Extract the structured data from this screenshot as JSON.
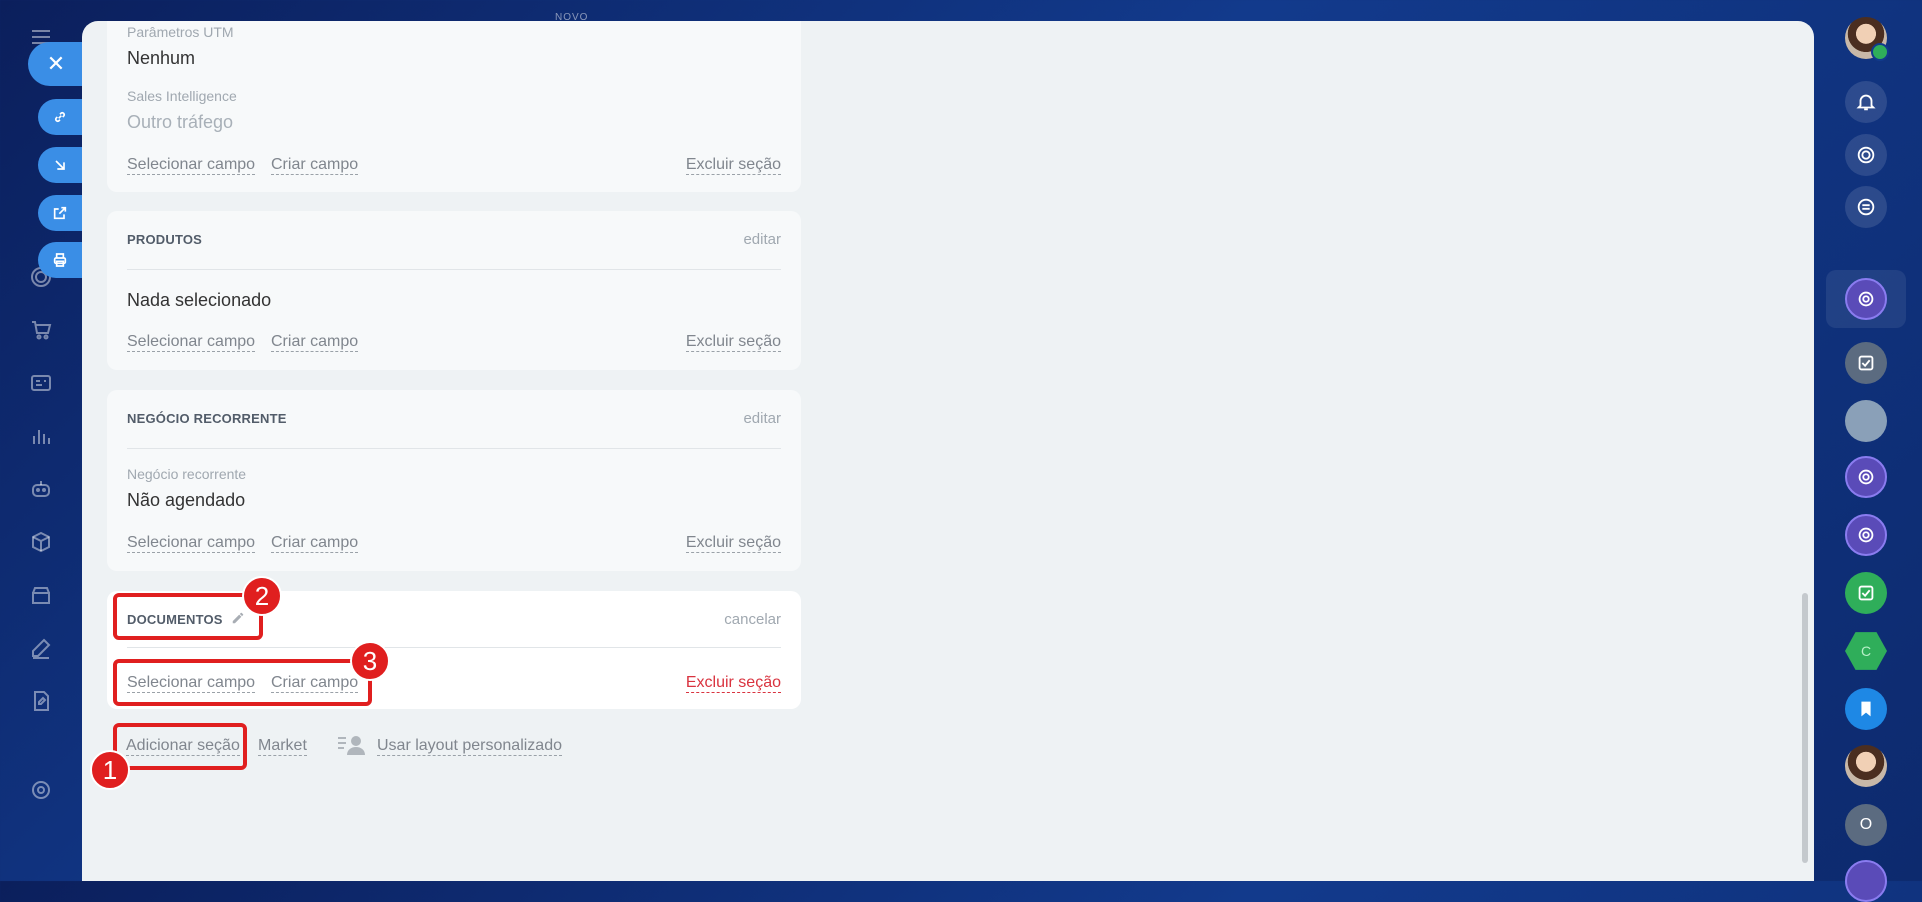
{
  "top_label": "NOVO",
  "sections": {
    "utm": {
      "utm_label": "Parâmetros UTM",
      "utm_value": "Nenhum",
      "si_label": "Sales Intelligence",
      "si_value": "Outro tráfego",
      "select_field": "Selecionar campo",
      "create_field": "Criar campo",
      "delete_section": "Excluir seção"
    },
    "produtos": {
      "title": "PRODUTOS",
      "edit": "editar",
      "value": "Nada selecionado",
      "select_field": "Selecionar campo",
      "create_field": "Criar campo",
      "delete_section": "Excluir seção"
    },
    "recorrente": {
      "title": "NEGÓCIO RECORRENTE",
      "edit": "editar",
      "field_label": "Negócio recorrente",
      "field_value": "Não agendado",
      "select_field": "Selecionar campo",
      "create_field": "Criar campo",
      "delete_section": "Excluir seção"
    },
    "documentos": {
      "title": "DOCUMENTOS",
      "cancel": "cancelar",
      "select_field": "Selecionar campo",
      "create_field": "Criar campo",
      "delete_section": "Excluir seção"
    }
  },
  "bottom": {
    "add_section": "Adicionar seção",
    "market": "Market",
    "custom_layout": "Usar layout personalizado"
  },
  "annotations": [
    "1",
    "2",
    "3"
  ],
  "right_rail": {
    "hex_letter": "C",
    "circle_letter": "O"
  },
  "colors": {
    "background": "#123a8c",
    "accent": "#3a8ee6",
    "danger": "#d9333f",
    "annotation": "#e01f1f"
  }
}
